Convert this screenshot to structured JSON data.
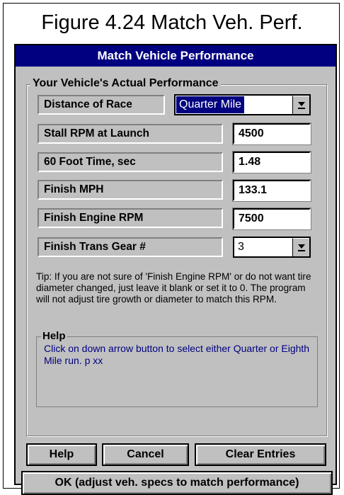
{
  "figure": {
    "title": "Figure 4.24  Match Veh. Perf."
  },
  "dialog": {
    "title": "Match Vehicle Performance",
    "group_label": "Your Vehicle's Actual Performance",
    "rows": [
      {
        "label": "Distance of Race",
        "value": "Quarter Mile"
      },
      {
        "label": "Stall RPM at Launch",
        "value": "4500"
      },
      {
        "label": "60 Foot Time, sec",
        "value": "1.48"
      },
      {
        "label": "Finish MPH",
        "value": "133.1"
      },
      {
        "label": "Finish Engine RPM",
        "value": "7500"
      },
      {
        "label": "Finish Trans Gear #",
        "value": "3"
      }
    ],
    "tip": "Tip:  If you are not sure of 'Finish Engine RPM' or do not want tire diameter changed, just leave it blank or set it to 0.  The program will not adjust tire growth or diameter to match this RPM.",
    "help": {
      "title": "Help",
      "text": "Click on down arrow button to select either Quarter or Eighth Mile run.  p xx"
    },
    "buttons": {
      "help": "Help",
      "cancel": "Cancel",
      "clear": "Clear Entries",
      "ok": "OK (adjust veh. specs to match performance)"
    }
  },
  "colors": {
    "titlebar": "#000080",
    "dialog_bg": "#c0c0c0",
    "help_text": "#000080"
  }
}
